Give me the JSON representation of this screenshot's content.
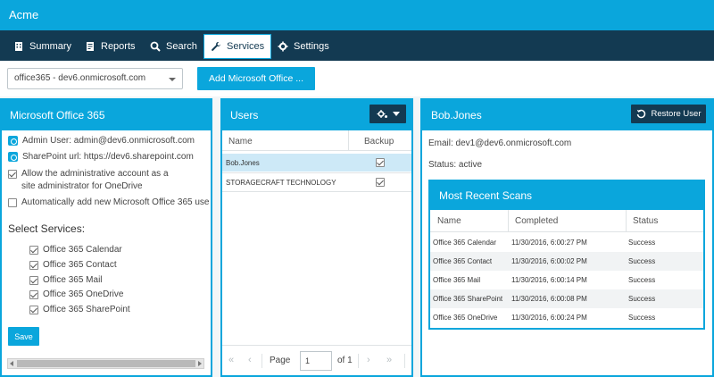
{
  "app": {
    "title": "Acme"
  },
  "nav": [
    {
      "label": "Summary",
      "icon": "building-icon"
    },
    {
      "label": "Reports",
      "icon": "reports-icon"
    },
    {
      "label": "Search",
      "icon": "search-icon"
    },
    {
      "label": "Services",
      "icon": "wrench-icon",
      "active": true
    },
    {
      "label": "Settings",
      "icon": "gear-icon"
    }
  ],
  "controls": {
    "tenant_select": "office365 - dev6.onmicrosoft.com",
    "add_button": "Add Microsoft Office ..."
  },
  "left_panel": {
    "title": "Microsoft Office 365",
    "admin_user": "Admin User: admin@dev6.onmicrosoft.com",
    "sharepoint_url": "SharePoint url: https://dev6.sharepoint.com",
    "allow_admin_line1": "Allow the administrative account as a",
    "allow_admin_line2": "site administrator for OneDrive",
    "auto_add": "Automatically add new Microsoft Office 365 use",
    "services_label": "Select Services:",
    "services": [
      "Office 365 Calendar",
      "Office 365 Contact",
      "Office 365 Mail",
      "Office 365 OneDrive",
      "Office 365 SharePoint"
    ],
    "save": "Save"
  },
  "users_panel": {
    "title": "Users",
    "col_name": "Name",
    "col_backup": "Backup",
    "rows": [
      {
        "name": "Bob.Jones",
        "backup": true,
        "selected": true
      },
      {
        "name": "STORAGECRAFT TECHNOLOGY",
        "backup": true,
        "selected": false
      }
    ],
    "pager": {
      "page_label": "Page",
      "page_value": "1",
      "of_label": "of 1"
    }
  },
  "user_detail": {
    "title": "Bob.Jones",
    "restore_button": "Restore User",
    "email": "Email: dev1@dev6.onmicrosoft.com",
    "status": "Status: active",
    "scans": {
      "title": "Most Recent Scans",
      "col_name": "Name",
      "col_completed": "Completed",
      "col_status": "Status",
      "rows": [
        {
          "name": "Office 365 Calendar",
          "completed": "11/30/2016, 6:00:27 PM",
          "status": "Success"
        },
        {
          "name": "Office 365 Contact",
          "completed": "11/30/2016, 6:00:02 PM",
          "status": "Success"
        },
        {
          "name": "Office 365 Mail",
          "completed": "11/30/2016, 6:00:14 PM",
          "status": "Success"
        },
        {
          "name": "Office 365 SharePoint",
          "completed": "11/30/2016, 6:00:08 PM",
          "status": "Success"
        },
        {
          "name": "Office 365 OneDrive",
          "completed": "11/30/2016, 6:00:24 PM",
          "status": "Success"
        }
      ]
    }
  },
  "colors": {
    "accent": "#0aa6dc",
    "nav_bg": "#133a52",
    "selected_row": "#cde9f7"
  }
}
